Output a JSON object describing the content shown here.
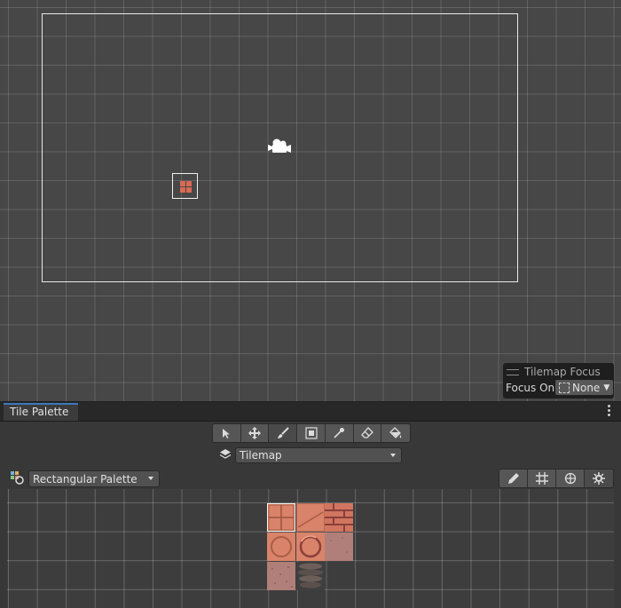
{
  "scene_view": {
    "camera_icon": "camera-icon",
    "tile_object_icon": "tile-icon"
  },
  "focus_overlay": {
    "title": "Tilemap Focus",
    "focus_label": "Focus On",
    "focus_value": "None"
  },
  "tile_palette": {
    "tab_title": "Tile Palette",
    "menu_icon": "kebab-menu-icon",
    "toolbar": [
      {
        "name": "select-tool",
        "icon": "arrow-icon",
        "active": false
      },
      {
        "name": "move-tool",
        "icon": "move-icon",
        "active": false
      },
      {
        "name": "paint-tool",
        "icon": "brush-icon",
        "active": true
      },
      {
        "name": "box-fill-tool",
        "icon": "box-fill-icon",
        "active": false
      },
      {
        "name": "picker-tool",
        "icon": "eyedropper-icon",
        "active": false
      },
      {
        "name": "erase-tool",
        "icon": "eraser-icon",
        "active": false
      },
      {
        "name": "fill-tool",
        "icon": "bucket-icon",
        "active": false
      }
    ],
    "active_tilemap": "Tilemap",
    "palette_select": "Rectangular Palette",
    "right_tools": [
      {
        "name": "edit-palette-button",
        "icon": "pencil-icon"
      },
      {
        "name": "grid-toggle-button",
        "icon": "grid-icon"
      },
      {
        "name": "gizmo-toggle-button",
        "icon": "gizmo-icon"
      },
      {
        "name": "palette-settings-button",
        "icon": "settings-icon"
      }
    ],
    "tiles": [
      {
        "name": "tile-cross",
        "selected": true
      },
      {
        "name": "tile-diagonal"
      },
      {
        "name": "tile-bricks"
      },
      {
        "name": "tile-circle"
      },
      {
        "name": "tile-circle-alt"
      },
      {
        "name": "tile-plain"
      },
      {
        "name": "tile-dotted"
      },
      {
        "name": "tile-stones"
      }
    ]
  },
  "colors": {
    "scene_background": "#474747",
    "panel_background": "#383838",
    "tab_accent": "#3a79bb",
    "tile_orange": "#d9836a",
    "tile_pink": "#b07f79"
  }
}
